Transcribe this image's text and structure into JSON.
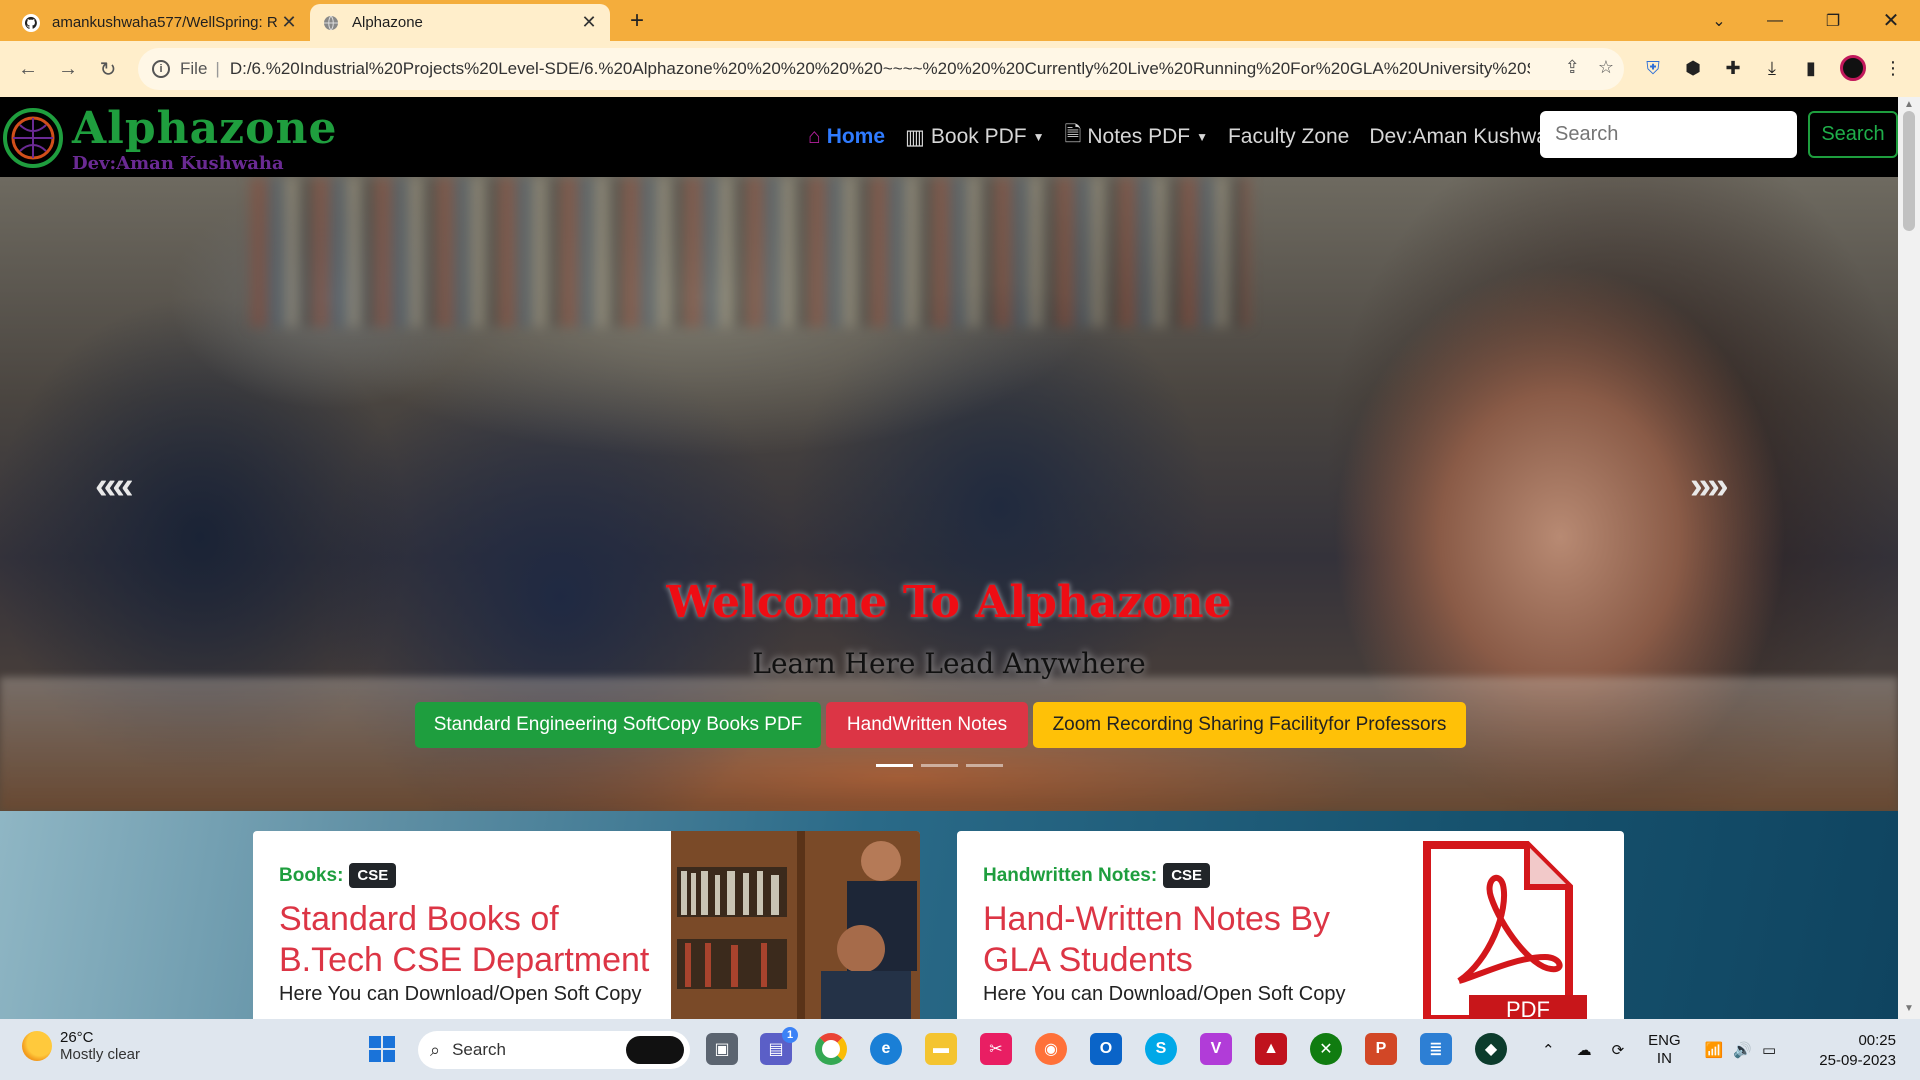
{
  "browser": {
    "tabs": [
      {
        "title": "amankushwaha577/WellSpring: R",
        "favicon": "github-icon",
        "active": false
      },
      {
        "title": "Alphazone",
        "favicon": "globe-icon",
        "active": true
      }
    ],
    "omnibox": {
      "scheme_label": "File",
      "url": "D:/6.%20Industrial%20Projects%20Level-SDE/6.%20Alphazone%20%20%20%20%20~~~~%20%20%20Currently%20Live%20Running%20For%20GLA%20University%20S..."
    }
  },
  "site": {
    "brand": "Alphazone",
    "brand_sub": "Dev:Aman Kushwaha",
    "nav": {
      "home": "Home",
      "book_pdf": "Book PDF",
      "notes_pdf": "Notes PDF",
      "faculty_zone": "Faculty Zone",
      "dev": "Dev:Aman Kushwaha"
    },
    "search": {
      "placeholder": "Search",
      "button": "Search"
    }
  },
  "hero": {
    "title": "Welcome To Alphazone",
    "subtitle": "Learn Here Lead Anywhere",
    "buttons": [
      "Standard Engineering SoftCopy Books PDF",
      "HandWritten Notes",
      "Zoom Recording Sharing Facilityfor Professors"
    ],
    "slide_count": 3,
    "active_slide": 1
  },
  "cards": [
    {
      "label": "Books:",
      "badge": "CSE",
      "heading": "Standard Books of B.Tech CSE Department",
      "desc": "Here You can Download/Open Soft Copy"
    },
    {
      "label": "Handwritten Notes:",
      "badge": "CSE",
      "heading": "Hand-Written Notes By GLA Students",
      "desc": "Here You can Download/Open Soft Copy",
      "image_text": "PDF"
    }
  ],
  "taskbar": {
    "weather_temp": "26°C",
    "weather_cond": "Mostly clear",
    "search_label": "Search",
    "lang_top": "ENG",
    "lang_bottom": "IN",
    "time": "00:25",
    "date": "25-09-2023",
    "teams_badge": "1"
  }
}
